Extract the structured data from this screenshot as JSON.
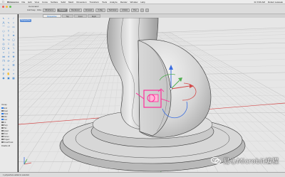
{
  "menubar": {
    "app_name": "Rhinoceros",
    "items": [
      "File",
      "Edit",
      "View",
      "Curve",
      "Surface",
      "Solid",
      "Mesh",
      "Dimension",
      "Transform",
      "Tools",
      "Analyze",
      "Render",
      "Window",
      "Help"
    ],
    "status_right": [
      "Fri 8:36 AM",
      "Robert Lukasek"
    ]
  },
  "toolbar": {
    "command_prompt": "Command:",
    "buttons": [
      "Wireframe",
      "Shaded",
      "Rendered",
      "Ghosted",
      "X-Ray",
      "Technical",
      "Artistic",
      "Pen"
    ],
    "active_index": 1,
    "grid_label": "Grid Snap",
    "ortho_label": "Ortho"
  },
  "view_tabs": {
    "tabs": [
      "Perspective",
      "Top",
      "Front",
      "Right"
    ],
    "active_index": 0
  },
  "viewport": {
    "label": "Perspective",
    "command_text": "Command:"
  },
  "osnap": {
    "header": "Osnap",
    "items": [
      {
        "label": "End",
        "checked": true
      },
      {
        "label": "Near",
        "checked": false
      },
      {
        "label": "Point",
        "checked": true
      },
      {
        "label": "Mid",
        "checked": false
      },
      {
        "label": "Cen",
        "checked": true
      },
      {
        "label": "Int",
        "checked": false
      },
      {
        "label": "Perp",
        "checked": false
      },
      {
        "label": "Tan",
        "checked": false
      },
      {
        "label": "Quad",
        "checked": false
      },
      {
        "label": "Knot",
        "checked": false
      },
      {
        "label": "Vertex",
        "checked": false
      },
      {
        "label": "Project",
        "checked": false
      },
      {
        "label": "SmartTrack",
        "checked": false
      }
    ],
    "footer": "Disable All"
  },
  "statusbar": {
    "text": "1 polysurface added to selection"
  },
  "watermark": {
    "text": "易心Microbit编程"
  },
  "colors": {
    "background": "#e6e6e6",
    "grid_minor": "#d2d2d2",
    "grid_major": "#b3b3b3",
    "axis_x": "#d34a4a",
    "axis_y": "#4fae4f",
    "model_fill": "#cfcfcf",
    "highlight": "#ff2f9a",
    "gumball_z": "#3a6de0"
  }
}
